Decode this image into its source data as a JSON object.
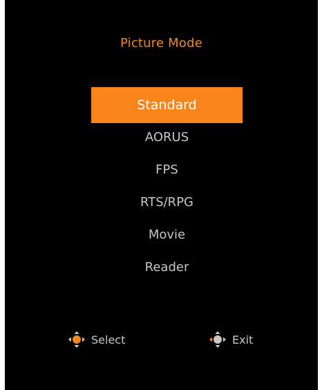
{
  "menu": {
    "title": "Picture Mode",
    "items": [
      {
        "label": "Standard",
        "selected": true
      },
      {
        "label": "AORUS",
        "selected": false
      },
      {
        "label": "FPS",
        "selected": false
      },
      {
        "label": "RTS/RPG",
        "selected": false
      },
      {
        "label": "Movie",
        "selected": false
      },
      {
        "label": "Reader",
        "selected": false
      }
    ]
  },
  "hints": {
    "select_label": "Select",
    "exit_label": "Exit",
    "select_icon": "joystick-press-center-icon",
    "exit_icon": "joystick-left-icon"
  },
  "colors": {
    "accent": "#f7851c",
    "background": "#000000",
    "text": "#c7c7c7"
  }
}
